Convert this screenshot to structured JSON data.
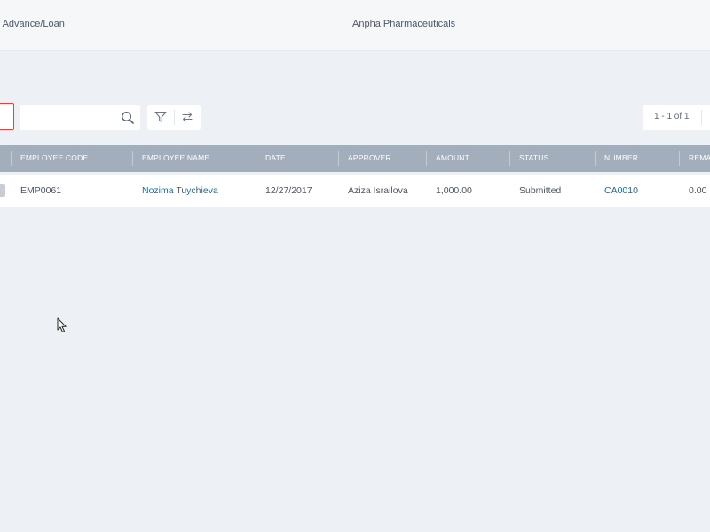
{
  "header": {
    "breadcrumb": "n Advance/Loan",
    "company": "Anpha Pharmaceuticals"
  },
  "toolbar": {
    "search_value": "",
    "search_placeholder": "",
    "pager_text": "1 - 1 of 1"
  },
  "icons": {
    "search": "search-icon",
    "filter": "filter-icon",
    "swap": "swap-arrows-icon",
    "cursor": "mouse-pointer-icon"
  },
  "colors": {
    "header_row": "#a2aebb",
    "link": "#1f6b9a",
    "highlight_border": "#e0423f",
    "background": "#edf0f4"
  },
  "table": {
    "columns": [
      "EMPLOYEE CODE",
      "EMPLOYEE NAME",
      "DATE",
      "APPROVER",
      "AMOUNT",
      "STATUS",
      "NUMBER",
      "REMA"
    ],
    "rows": [
      {
        "employee_code": "EMP0061",
        "employee_name": "Nozima Tuychieva",
        "date": "12/27/2017",
        "approver": "Aziza Israilova",
        "amount": "1,000.00",
        "status": "Submitted",
        "number": "CA0010",
        "remaining": "0.00"
      }
    ]
  }
}
